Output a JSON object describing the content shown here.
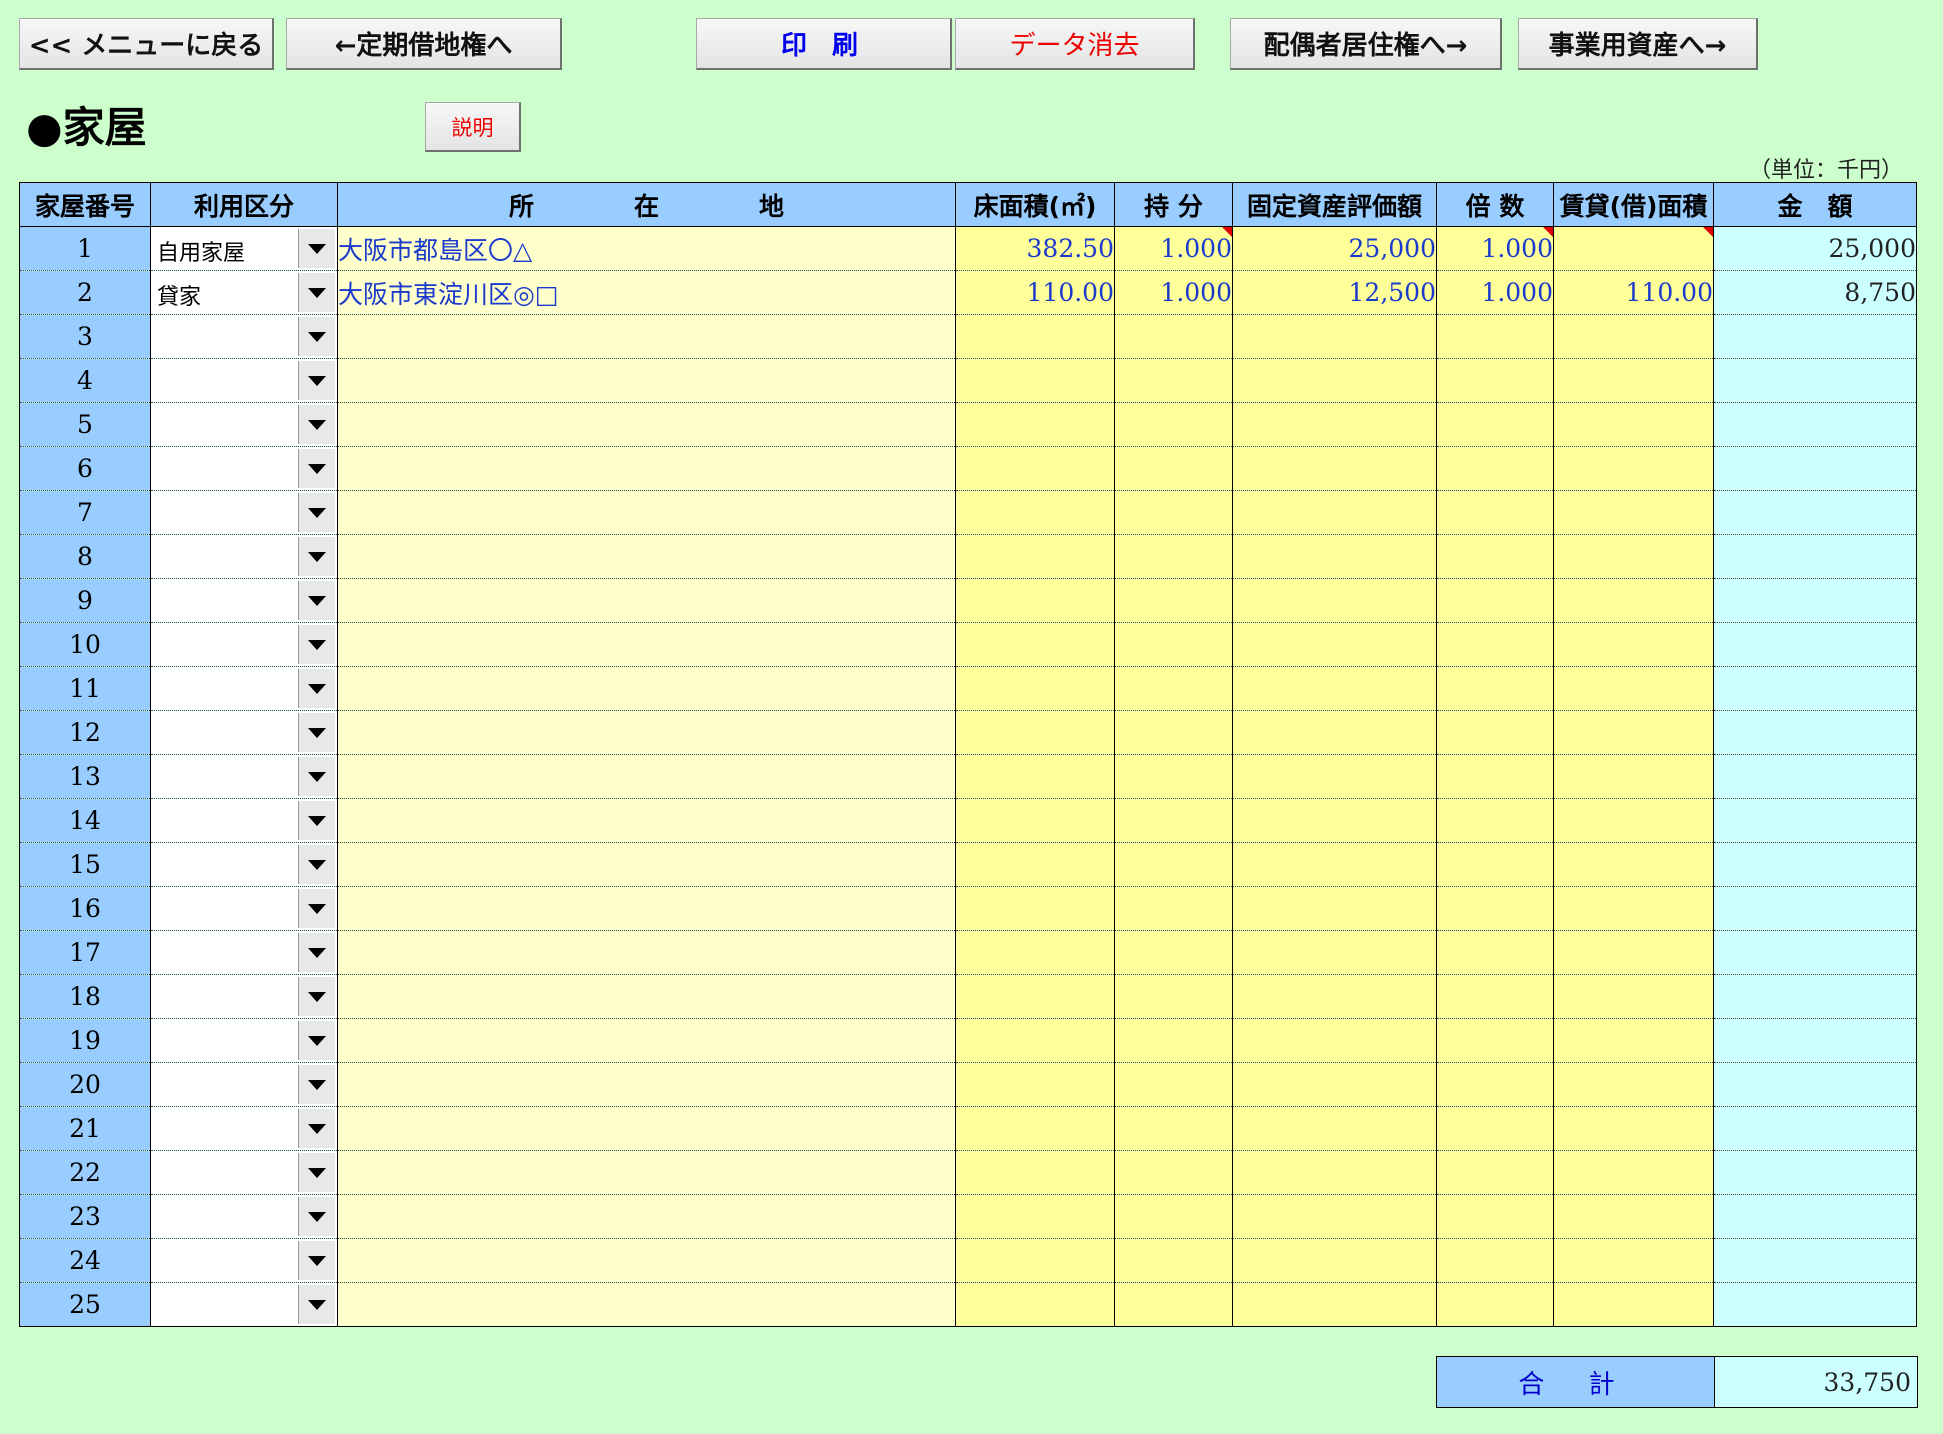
{
  "toolbar": {
    "back_menu": "<< メニューに戻る",
    "prev": "←定期借地権へ",
    "print": "印 刷",
    "clear": "データ消去",
    "next_spouse": "配偶者居住権へ→",
    "next_business": "事業用資産へ→"
  },
  "page": {
    "title": "●家屋",
    "explain_button": "説明",
    "unit": "（単位：千円）"
  },
  "table": {
    "headers": {
      "no": "家屋番号",
      "use": "利用区分",
      "address": "所　　　　在　　　　地",
      "area": "床面積(㎡)",
      "share": "持 分",
      "assessed": "固定資産評価額",
      "multiplier": "倍 数",
      "rental_area": "賃貸(借)面積",
      "amount": "金　額"
    },
    "rows": [
      {
        "no": "1",
        "use": "自用家屋",
        "address": "大阪市都島区〇△",
        "area": "382.50",
        "share": "1.000",
        "assessed": "25,000",
        "multiplier": "1.000",
        "rental_area": "",
        "amount": "25,000"
      },
      {
        "no": "2",
        "use": "貸家",
        "address": "大阪市東淀川区◎□",
        "area": "110.00",
        "share": "1.000",
        "assessed": "12,500",
        "multiplier": "1.000",
        "rental_area": "110.00",
        "amount": "8,750"
      },
      {
        "no": "3",
        "use": "",
        "address": "",
        "area": "",
        "share": "",
        "assessed": "",
        "multiplier": "",
        "rental_area": "",
        "amount": ""
      },
      {
        "no": "4",
        "use": "",
        "address": "",
        "area": "",
        "share": "",
        "assessed": "",
        "multiplier": "",
        "rental_area": "",
        "amount": ""
      },
      {
        "no": "5",
        "use": "",
        "address": "",
        "area": "",
        "share": "",
        "assessed": "",
        "multiplier": "",
        "rental_area": "",
        "amount": ""
      },
      {
        "no": "6",
        "use": "",
        "address": "",
        "area": "",
        "share": "",
        "assessed": "",
        "multiplier": "",
        "rental_area": "",
        "amount": ""
      },
      {
        "no": "7",
        "use": "",
        "address": "",
        "area": "",
        "share": "",
        "assessed": "",
        "multiplier": "",
        "rental_area": "",
        "amount": ""
      },
      {
        "no": "8",
        "use": "",
        "address": "",
        "area": "",
        "share": "",
        "assessed": "",
        "multiplier": "",
        "rental_area": "",
        "amount": ""
      },
      {
        "no": "9",
        "use": "",
        "address": "",
        "area": "",
        "share": "",
        "assessed": "",
        "multiplier": "",
        "rental_area": "",
        "amount": ""
      },
      {
        "no": "10",
        "use": "",
        "address": "",
        "area": "",
        "share": "",
        "assessed": "",
        "multiplier": "",
        "rental_area": "",
        "amount": ""
      },
      {
        "no": "11",
        "use": "",
        "address": "",
        "area": "",
        "share": "",
        "assessed": "",
        "multiplier": "",
        "rental_area": "",
        "amount": ""
      },
      {
        "no": "12",
        "use": "",
        "address": "",
        "area": "",
        "share": "",
        "assessed": "",
        "multiplier": "",
        "rental_area": "",
        "amount": ""
      },
      {
        "no": "13",
        "use": "",
        "address": "",
        "area": "",
        "share": "",
        "assessed": "",
        "multiplier": "",
        "rental_area": "",
        "amount": ""
      },
      {
        "no": "14",
        "use": "",
        "address": "",
        "area": "",
        "share": "",
        "assessed": "",
        "multiplier": "",
        "rental_area": "",
        "amount": ""
      },
      {
        "no": "15",
        "use": "",
        "address": "",
        "area": "",
        "share": "",
        "assessed": "",
        "multiplier": "",
        "rental_area": "",
        "amount": ""
      },
      {
        "no": "16",
        "use": "",
        "address": "",
        "area": "",
        "share": "",
        "assessed": "",
        "multiplier": "",
        "rental_area": "",
        "amount": ""
      },
      {
        "no": "17",
        "use": "",
        "address": "",
        "area": "",
        "share": "",
        "assessed": "",
        "multiplier": "",
        "rental_area": "",
        "amount": ""
      },
      {
        "no": "18",
        "use": "",
        "address": "",
        "area": "",
        "share": "",
        "assessed": "",
        "multiplier": "",
        "rental_area": "",
        "amount": ""
      },
      {
        "no": "19",
        "use": "",
        "address": "",
        "area": "",
        "share": "",
        "assessed": "",
        "multiplier": "",
        "rental_area": "",
        "amount": ""
      },
      {
        "no": "20",
        "use": "",
        "address": "",
        "area": "",
        "share": "",
        "assessed": "",
        "multiplier": "",
        "rental_area": "",
        "amount": ""
      },
      {
        "no": "21",
        "use": "",
        "address": "",
        "area": "",
        "share": "",
        "assessed": "",
        "multiplier": "",
        "rental_area": "",
        "amount": ""
      },
      {
        "no": "22",
        "use": "",
        "address": "",
        "area": "",
        "share": "",
        "assessed": "",
        "multiplier": "",
        "rental_area": "",
        "amount": ""
      },
      {
        "no": "23",
        "use": "",
        "address": "",
        "area": "",
        "share": "",
        "assessed": "",
        "multiplier": "",
        "rental_area": "",
        "amount": ""
      },
      {
        "no": "24",
        "use": "",
        "address": "",
        "area": "",
        "share": "",
        "assessed": "",
        "multiplier": "",
        "rental_area": "",
        "amount": ""
      },
      {
        "no": "25",
        "use": "",
        "address": "",
        "area": "",
        "share": "",
        "assessed": "",
        "multiplier": "",
        "rental_area": "",
        "amount": ""
      }
    ],
    "total_label": "合 計",
    "total_value": "33,750"
  },
  "colors": {
    "background": "#ccffcc",
    "header": "#99ccff",
    "input_cell": "#ffff99",
    "address_cell": "#ffffcc",
    "amount_cell": "#ccffff",
    "input_text": "#1a3acc",
    "comment_marker": "#e00000"
  },
  "icons": {
    "dropdown": "dropdown-arrow-icon",
    "comment": "comment-marker-icon"
  }
}
